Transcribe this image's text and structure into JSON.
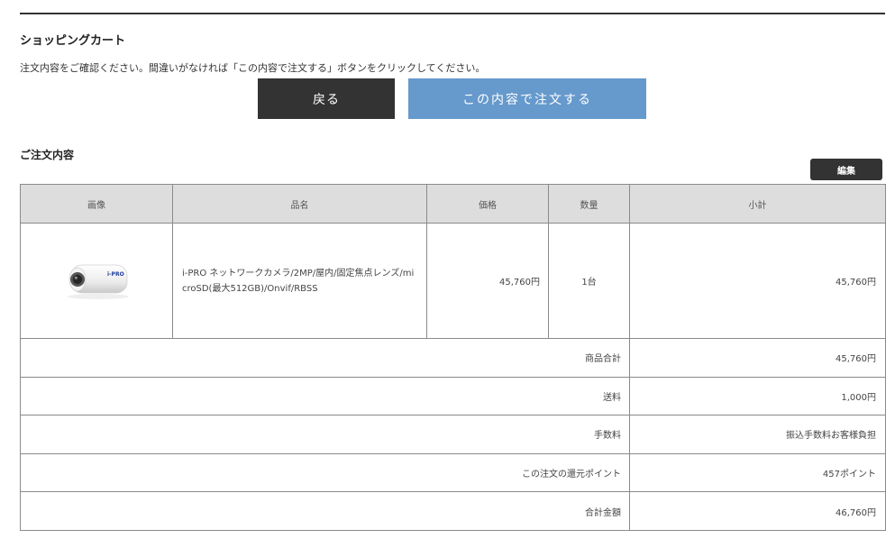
{
  "page": {
    "title": "ショッピングカート",
    "instruction": "注文内容をご確認ください。間違いがなければ「この内容で注文する」ボタンをクリックしてください。"
  },
  "buttons": {
    "back": "戻る",
    "order": "この内容で注文する",
    "edit": "編集"
  },
  "order": {
    "section_title": "ご注文内容",
    "headers": {
      "image": "画像",
      "name": "品名",
      "price": "価格",
      "qty": "数量",
      "subtotal": "小計"
    },
    "item": {
      "image_brand": "i-PRO",
      "name": "i-PRO ネットワークカメラ/2MP/屋内/固定焦点レンズ/microSD(最大512GB)/Onvif/RBSS",
      "price": "45,760円",
      "qty": "1台",
      "subtotal": "45,760円"
    },
    "summary": [
      {
        "label": "商品合計",
        "value": "45,760円"
      },
      {
        "label": "送料",
        "value": "1,000円"
      },
      {
        "label": "手数料",
        "value": "振込手数料お客様負担"
      },
      {
        "label": "この注文の還元ポイント",
        "value": "457ポイント"
      },
      {
        "label": "合計金額",
        "value": "46,760円"
      }
    ]
  },
  "colors": {
    "back_button": "#333333",
    "order_button": "#6699cc",
    "header_bg": "#dddddd"
  }
}
